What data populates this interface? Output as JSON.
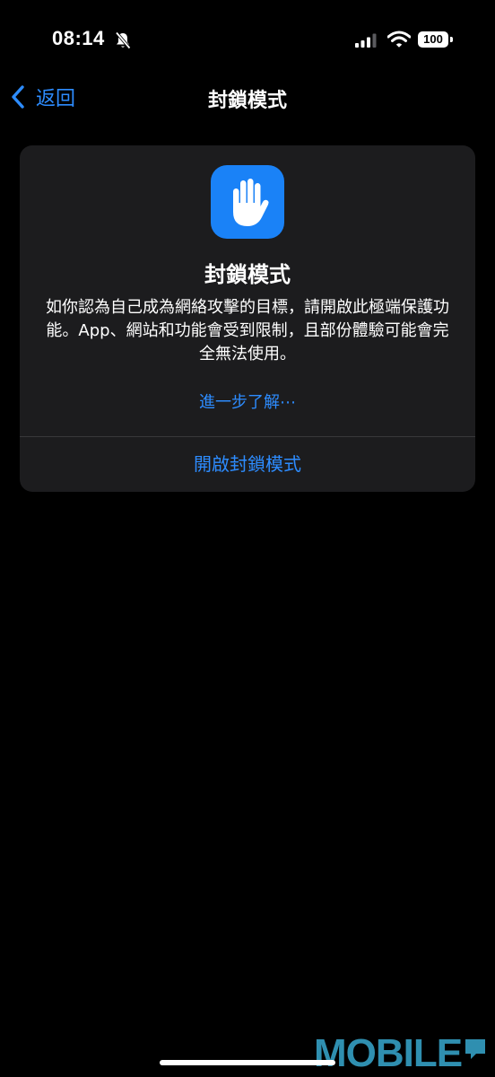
{
  "status_bar": {
    "time": "08:14",
    "battery": "100",
    "icons": [
      "bell-off-icon",
      "cellular-signal-icon",
      "wifi-icon",
      "battery-icon"
    ]
  },
  "nav": {
    "back_label": "返回",
    "title": "封鎖模式"
  },
  "card": {
    "icon": "raised-hand-icon",
    "title": "封鎖模式",
    "description": "如你認為自己成為網絡攻擊的目標，請開啟此極端保護功能。App、網站和功能會受到限制，且部份體驗可能會完全無法使用。",
    "learn_more": "進一步了解⋯",
    "enable_button": "開啟封鎖模式"
  },
  "colors": {
    "background": "#000000",
    "card": "#1c1c1e",
    "accent": "#2d8cff",
    "icon_bg": "#1a82f7"
  },
  "watermark": {
    "text": "MOBILE"
  }
}
